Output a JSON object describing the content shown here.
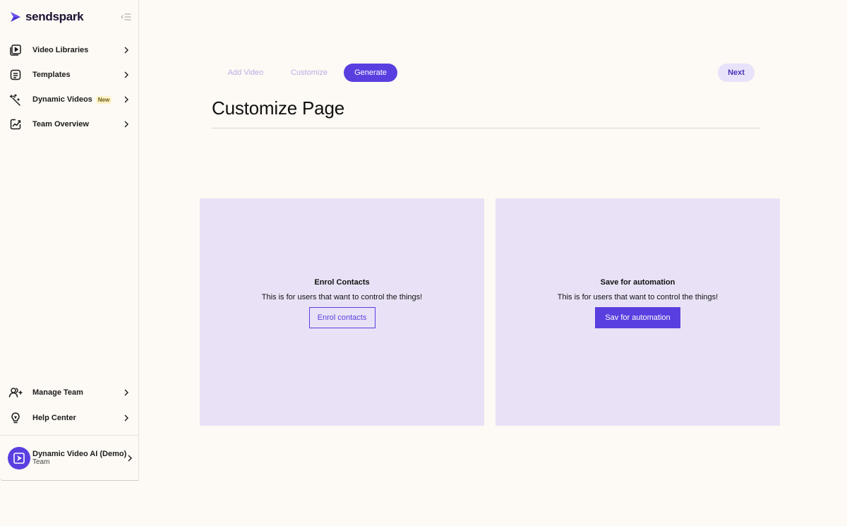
{
  "sidebar": {
    "logo_text": "sendspark",
    "items": [
      {
        "label": "Video Libraries",
        "icon": "video-library-icon"
      },
      {
        "label": "Templates",
        "icon": "templates-icon"
      },
      {
        "label": "Dynamic Videos",
        "icon": "magic-wand-icon",
        "badge": "New"
      },
      {
        "label": "Team Overview",
        "icon": "chart-line-icon"
      }
    ],
    "bottom_items": [
      {
        "label": "Manage Team",
        "icon": "users-icon"
      },
      {
        "label": "Help Center",
        "icon": "lightbulb-icon"
      }
    ],
    "account": {
      "name": "Dynamic Video AI (Demo)",
      "subtitle": "Team"
    }
  },
  "steps": [
    {
      "label": "Add Video",
      "state": "inactive"
    },
    {
      "label": "Customize",
      "state": "inactive"
    },
    {
      "label": "Generate",
      "state": "active"
    }
  ],
  "next_label": "Next",
  "page_title": "Customize Page",
  "cards": [
    {
      "title": "Enrol Contacts",
      "description": "This is for users that want to control the things!",
      "button": "Enrol contacts"
    },
    {
      "title": "Save for automation",
      "description": "This is for users that want to control the things!",
      "button": "Sav for automation"
    }
  ],
  "colors": {
    "accent": "#5a3fe0",
    "card_bg": "#e9e2f6",
    "page_bg": "#fdf9f4",
    "step_muted": "#b9aee6"
  }
}
